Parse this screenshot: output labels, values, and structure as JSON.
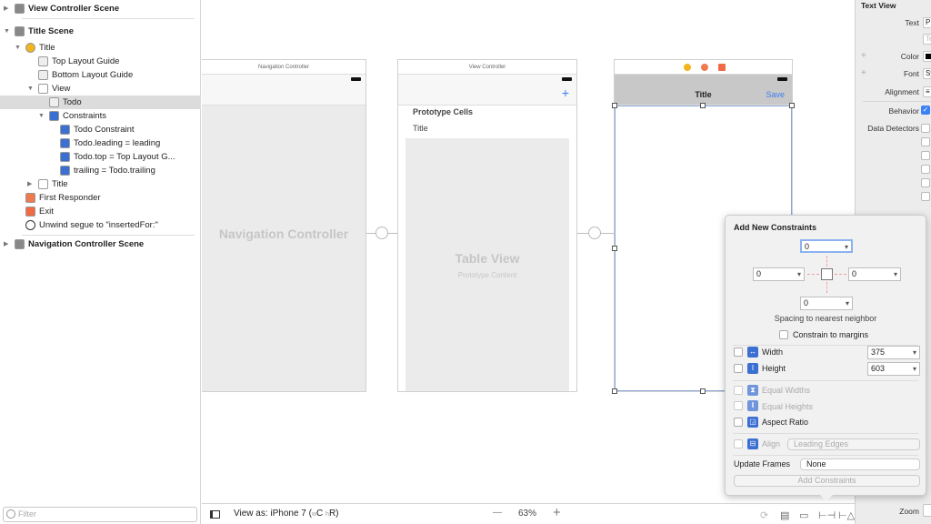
{
  "outline": {
    "items": [
      {
        "label": "View Controller Scene",
        "icon": "scene-icon",
        "level": 0,
        "expanded": false
      },
      {
        "label": "Title Scene",
        "icon": "scene-icon",
        "level": 0,
        "expanded": true
      },
      {
        "label": "Title",
        "icon": "view-controller-icon",
        "level": 1,
        "expanded": true
      },
      {
        "label": "Top Layout Guide",
        "icon": "layout-guide-icon",
        "level": 2
      },
      {
        "label": "Bottom Layout Guide",
        "icon": "layout-guide-icon",
        "level": 2
      },
      {
        "label": "View",
        "icon": "view-icon",
        "level": 2,
        "expanded": true
      },
      {
        "label": "Todo",
        "icon": "text-view-icon",
        "level": 3,
        "selected": true
      },
      {
        "label": "Constraints",
        "icon": "constraints-icon",
        "level": 3,
        "expanded": true
      },
      {
        "label": "Todo Constraint",
        "icon": "constraint-icon",
        "level": 4
      },
      {
        "label": "Todo.leading = leading",
        "icon": "constraint-icon",
        "level": 4
      },
      {
        "label": "Todo.top = Top Layout G...",
        "icon": "constraint-icon",
        "level": 4
      },
      {
        "label": "trailing = Todo.trailing",
        "icon": "constraint-icon",
        "level": 4
      },
      {
        "label": "Title",
        "icon": "navigation-item-icon",
        "level": 2,
        "expanded": false
      },
      {
        "label": "First Responder",
        "icon": "first-responder-icon",
        "level": 1
      },
      {
        "label": "Exit",
        "icon": "exit-icon",
        "level": 1
      },
      {
        "label": "Unwind segue to \"insertedFor:\"",
        "icon": "unwind-segue-icon",
        "level": 1
      },
      {
        "label": "Navigation Controller Scene",
        "icon": "scene-icon",
        "level": 0,
        "expanded": false
      }
    ],
    "filter_placeholder": "Filter"
  },
  "canvas": {
    "nav_controller": {
      "header": "Navigation Controller",
      "body": "Navigation Controller"
    },
    "view_controller": {
      "header": "View Controller",
      "prototype_cells": "Prototype Cells",
      "cell_title": "Title",
      "table_view": "Table View",
      "prototype_content": "Prototype Content"
    },
    "title_scene": {
      "nav_title": "Title",
      "save": "Save"
    }
  },
  "bottom_bar": {
    "view_as": "View as: iPhone 7 (",
    "w": "w",
    "c": "C ",
    "h": "h",
    "r": "R)",
    "zoom": "63%",
    "minus": "—",
    "plus": "+"
  },
  "inspector": {
    "section": "Text View",
    "text_label": "Text",
    "text_value": "P",
    "text_placeholder": "Te",
    "color_label": "Color",
    "font_label": "Font",
    "font_value": "Sy",
    "alignment_label": "Alignment",
    "behavior_label": "Behavior",
    "behavior_checked": true,
    "data_detectors_label": "Data Detectors",
    "zoom_label": "Zoom"
  },
  "popover": {
    "title": "Add New Constraints",
    "top": "0",
    "left": "0",
    "right": "0",
    "bottom": "0",
    "spacing_label": "Spacing to nearest neighbor",
    "constrain_margins": "Constrain to margins",
    "width_label": "Width",
    "width_value": "375",
    "height_label": "Height",
    "height_value": "603",
    "equal_widths": "Equal Widths",
    "equal_heights": "Equal Heights",
    "aspect_ratio": "Aspect Ratio",
    "align_label": "Align",
    "align_value": "Leading Edges",
    "update_frames_label": "Update Frames",
    "update_frames_value": "None",
    "add_button": "Add Constraints"
  },
  "colors": {
    "accent": "#3b6fd1",
    "save": "#3d7cf5",
    "selection_border": "#8aa6d6"
  }
}
